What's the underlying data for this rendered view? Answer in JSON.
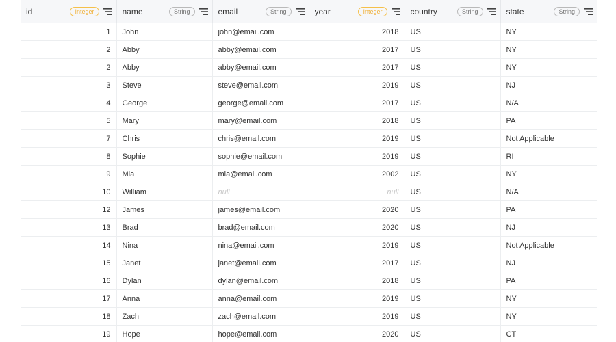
{
  "columns": [
    {
      "name": "id",
      "type": "Integer",
      "align": "right"
    },
    {
      "name": "name",
      "type": "String",
      "align": "left"
    },
    {
      "name": "email",
      "type": "String",
      "align": "left"
    },
    {
      "name": "year",
      "type": "Integer",
      "align": "right"
    },
    {
      "name": "country",
      "type": "String",
      "align": "left"
    },
    {
      "name": "state",
      "type": "String",
      "align": "left"
    }
  ],
  "null_label": "null",
  "colors": {
    "integer_badge": "#f0b13a",
    "string_badge": "#777777",
    "header_bg": "#f6f7f9",
    "null_text": "#c8c8c8"
  },
  "rows": [
    [
      "1",
      "John",
      "john@email.com",
      "2018",
      "US",
      "NY"
    ],
    [
      "2",
      "Abby",
      "abby@email.com",
      "2017",
      "US",
      "NY"
    ],
    [
      "2",
      "Abby",
      "abby@email.com",
      "2017",
      "US",
      "NY"
    ],
    [
      "3",
      "Steve",
      "steve@email.com",
      "2019",
      "US",
      "NJ"
    ],
    [
      "4",
      "George",
      "george@email.com",
      "2017",
      "US",
      "N/A"
    ],
    [
      "5",
      "Mary",
      "mary@email.com",
      "2018",
      "US",
      "PA"
    ],
    [
      "7",
      "Chris",
      "chris@email.com",
      "2019",
      "US",
      "Not Applicable"
    ],
    [
      "8",
      "Sophie",
      "sophie@email.com",
      "2019",
      "US",
      "RI"
    ],
    [
      "9",
      "Mia",
      "mia@email.com",
      "2002",
      "US",
      "NY"
    ],
    [
      "10",
      "William",
      null,
      null,
      "US",
      "N/A"
    ],
    [
      "12",
      "James",
      "james@email.com",
      "2020",
      "US",
      "PA"
    ],
    [
      "13",
      "Brad",
      "brad@email.com",
      "2020",
      "US",
      "NJ"
    ],
    [
      "14",
      "Nina",
      "nina@email.com",
      "2019",
      "US",
      "Not Applicable"
    ],
    [
      "15",
      "Janet",
      "janet@email.com",
      "2017",
      "US",
      "NJ"
    ],
    [
      "16",
      "Dylan",
      "dylan@email.com",
      "2018",
      "US",
      "PA"
    ],
    [
      "17",
      "Anna",
      "anna@email.com",
      "2019",
      "US",
      "NY"
    ],
    [
      "18",
      "Zach",
      "zach@email.com",
      "2019",
      "US",
      "NY"
    ],
    [
      "19",
      "Hope",
      "hope@email.com",
      "2020",
      "US",
      "CT"
    ]
  ]
}
